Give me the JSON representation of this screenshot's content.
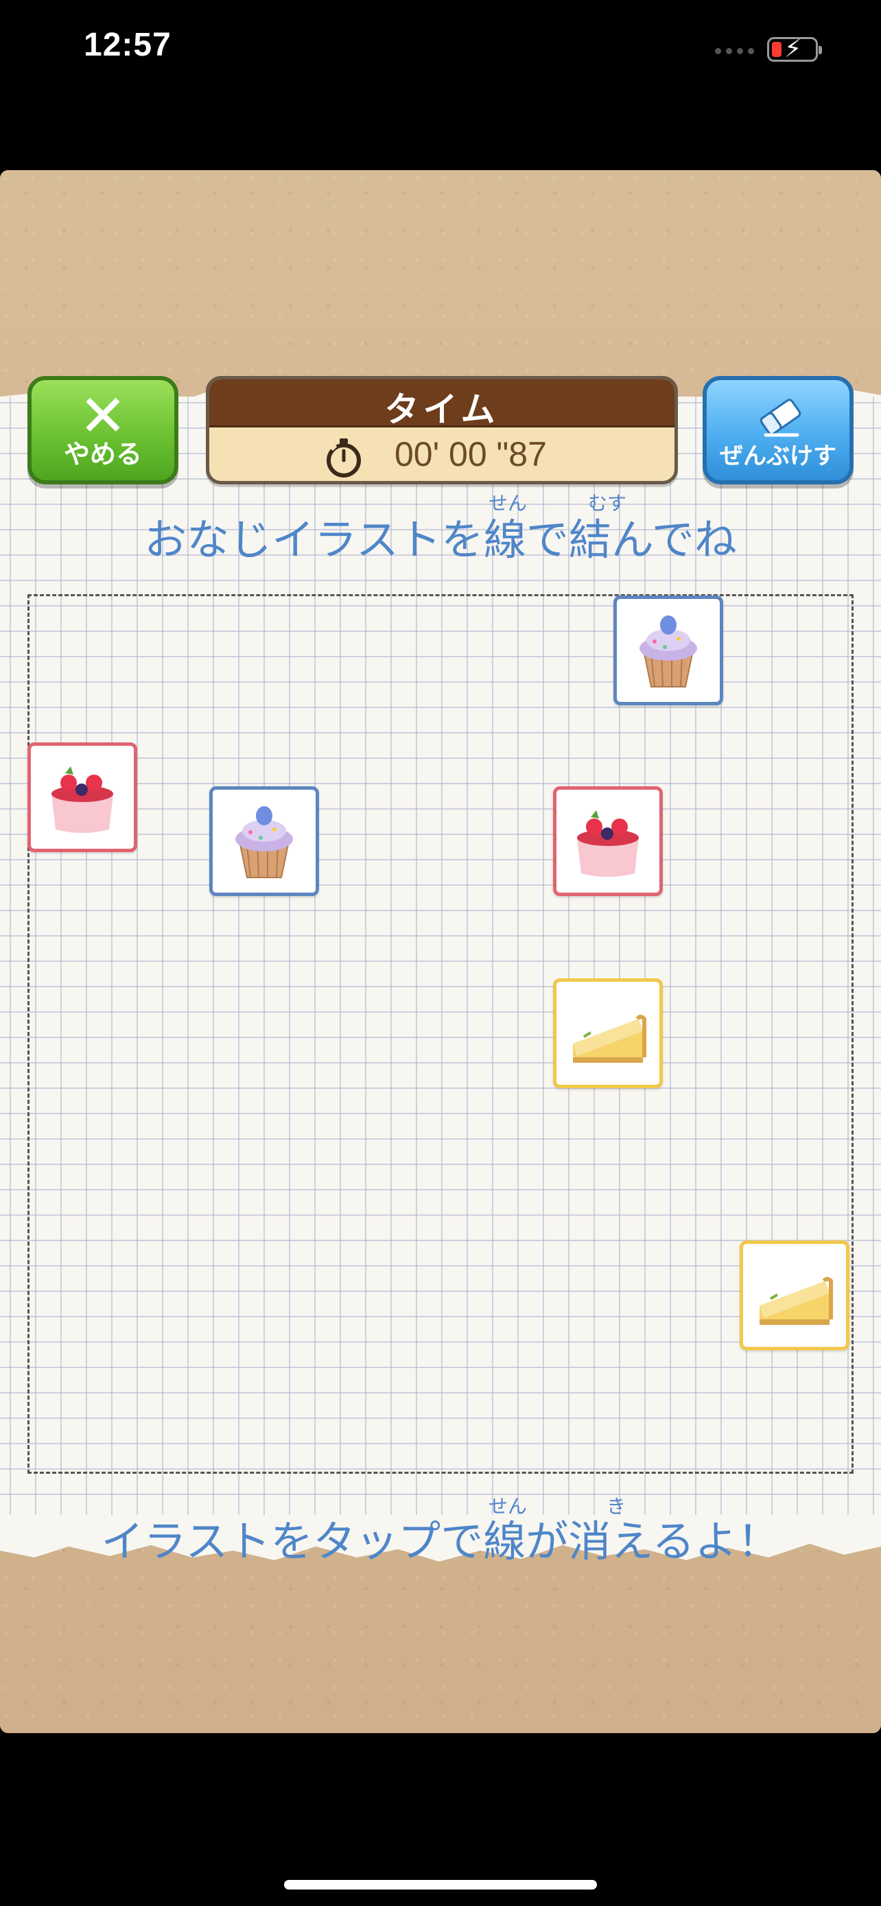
{
  "status_bar": {
    "time": "12:57"
  },
  "top_bar": {
    "quit_label": "やめる",
    "quit_icon": "close-icon",
    "timer_title": "タイム",
    "timer_value": "00' 00 \"87",
    "timer_icon": "stopwatch-icon",
    "erase_label": "ぜんぶけす",
    "erase_icon": "eraser-icon"
  },
  "instructions": {
    "top": "おなじイラストを線で結んでね",
    "top_ruby_1": "せん",
    "top_ruby_2": "むす",
    "bottom": "イラストをタップで線が消えるよ！",
    "bottom_ruby_1": "せん",
    "bottom_ruby_2": "き"
  },
  "tiles": [
    {
      "kind": "cupcake",
      "frame": "blue",
      "icon": "cupcake-icon"
    },
    {
      "kind": "berry-mousse",
      "frame": "red",
      "icon": "berry-cake-icon"
    },
    {
      "kind": "cupcake",
      "frame": "blue",
      "icon": "cupcake-icon"
    },
    {
      "kind": "berry-mousse",
      "frame": "red",
      "icon": "berry-cake-icon"
    },
    {
      "kind": "cheesecake",
      "frame": "yellow",
      "icon": "cheesecake-icon"
    },
    {
      "kind": "cheesecake",
      "frame": "yellow",
      "icon": "cheesecake-icon"
    }
  ],
  "colors": {
    "accent_text": "#4f86c8",
    "quit_button": "#6cc232",
    "erase_button": "#4eaef0",
    "timer_header": "#6e3d1c",
    "tile_blue": "#5d86c0",
    "tile_red": "#e06470",
    "tile_yellow": "#f2c84b"
  }
}
